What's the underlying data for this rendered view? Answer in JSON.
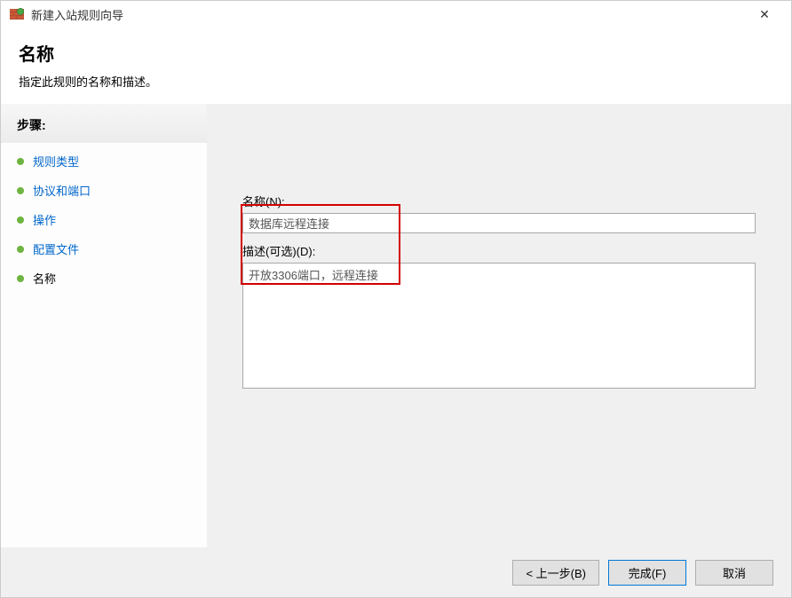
{
  "window": {
    "title": "新建入站规则向导",
    "close": "✕"
  },
  "header": {
    "heading": "名称",
    "subtitle": "指定此规则的名称和描述。"
  },
  "sidebar": {
    "title": "步骤:",
    "items": [
      {
        "label": "规则类型",
        "state": "completed"
      },
      {
        "label": "协议和端口",
        "state": "completed"
      },
      {
        "label": "操作",
        "state": "completed"
      },
      {
        "label": "配置文件",
        "state": "completed"
      },
      {
        "label": "名称",
        "state": "current"
      }
    ]
  },
  "form": {
    "name_label": "名称(N):",
    "name_value": "数据库远程连接",
    "desc_label": "描述(可选)(D):",
    "desc_value": "开放3306端口，远程连接"
  },
  "footer": {
    "back": "< 上一步(B)",
    "finish": "完成(F)",
    "cancel": "取消"
  }
}
